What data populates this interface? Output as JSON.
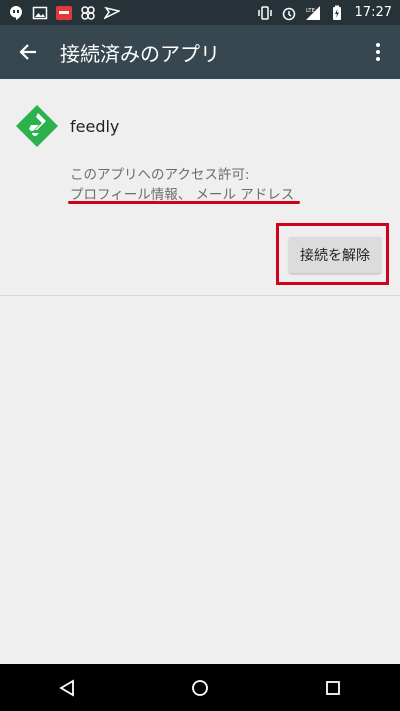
{
  "status_bar": {
    "time": "17:27",
    "left_icons": [
      "hangouts-icon",
      "image-icon",
      "app-red-icon",
      "fan-icon",
      "send-icon"
    ],
    "right_icons": [
      "vibrate-icon",
      "alarm-icon",
      "lte-signal-icon",
      "battery-icon"
    ],
    "network_label": "LTE"
  },
  "app_bar": {
    "title": "接続済みのアプリ"
  },
  "connected_app": {
    "name": "feedly",
    "permission_heading": "このアプリへのアクセス許可:",
    "permission_scopes": "プロフィール情報、 メール アドレス",
    "disconnect_label": "接続を解除"
  },
  "colors": {
    "app_bar": "#37474f",
    "status_bar": "#263238",
    "feedly_green": "#2bb24c",
    "highlight_red": "#d0021b"
  }
}
